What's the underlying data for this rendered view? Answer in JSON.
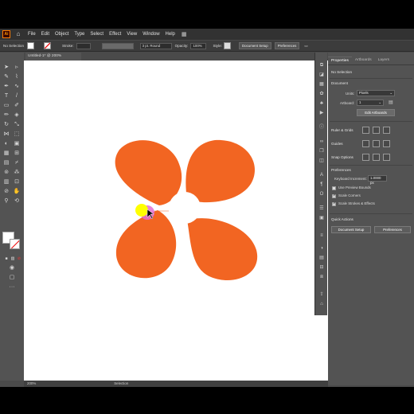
{
  "menubar": {
    "logo": "Ai",
    "items": [
      "File",
      "Edit",
      "Object",
      "Type",
      "Select",
      "Effect",
      "View",
      "Window",
      "Help"
    ]
  },
  "control": {
    "selection": "No Selection",
    "stroke_label": "Stroke:",
    "stroke_profile": "3 pt. Round",
    "opacity_label": "Opacity:",
    "opacity_value": "100%",
    "style_label": "Style:",
    "doc_setup": "Document Setup",
    "preferences": "Preferences"
  },
  "document": {
    "tab_title": "Untitled-1* @ 200% (RGB/Preview)"
  },
  "status": {
    "zoom": "200%",
    "tool": "Selection"
  },
  "panel": {
    "tabs": [
      "Properties",
      "Artboards",
      "Layers"
    ],
    "no_selection": "No Selection",
    "document_heading": "Document",
    "units_label": "Units:",
    "units_value": "Pixels",
    "artboard_label": "Artboard:",
    "artboard_value": "1",
    "edit_artboards": "Edit Artboards",
    "rulers_grids": "Ruler & Grids",
    "guides": "Guides",
    "snap_options": "Snap Options",
    "preferences_heading": "Preferences",
    "keyboard_increment_label": "Keyboard Increment:",
    "keyboard_increment_value": "1.0000 px",
    "use_preview_bounds": "Use Preview Bounds",
    "scale_corners": "Scale Corners",
    "scale_strokes": "Scale Strokes & Effects",
    "quick_actions": "Quick Actions",
    "qa_doc_setup": "Document Setup",
    "qa_preferences": "Preferences"
  },
  "colors": {
    "petal": "#f26522",
    "highlight_yellow": "#ffff00",
    "highlight_pink": "#e36fd3",
    "canvas": "#ffffff"
  }
}
